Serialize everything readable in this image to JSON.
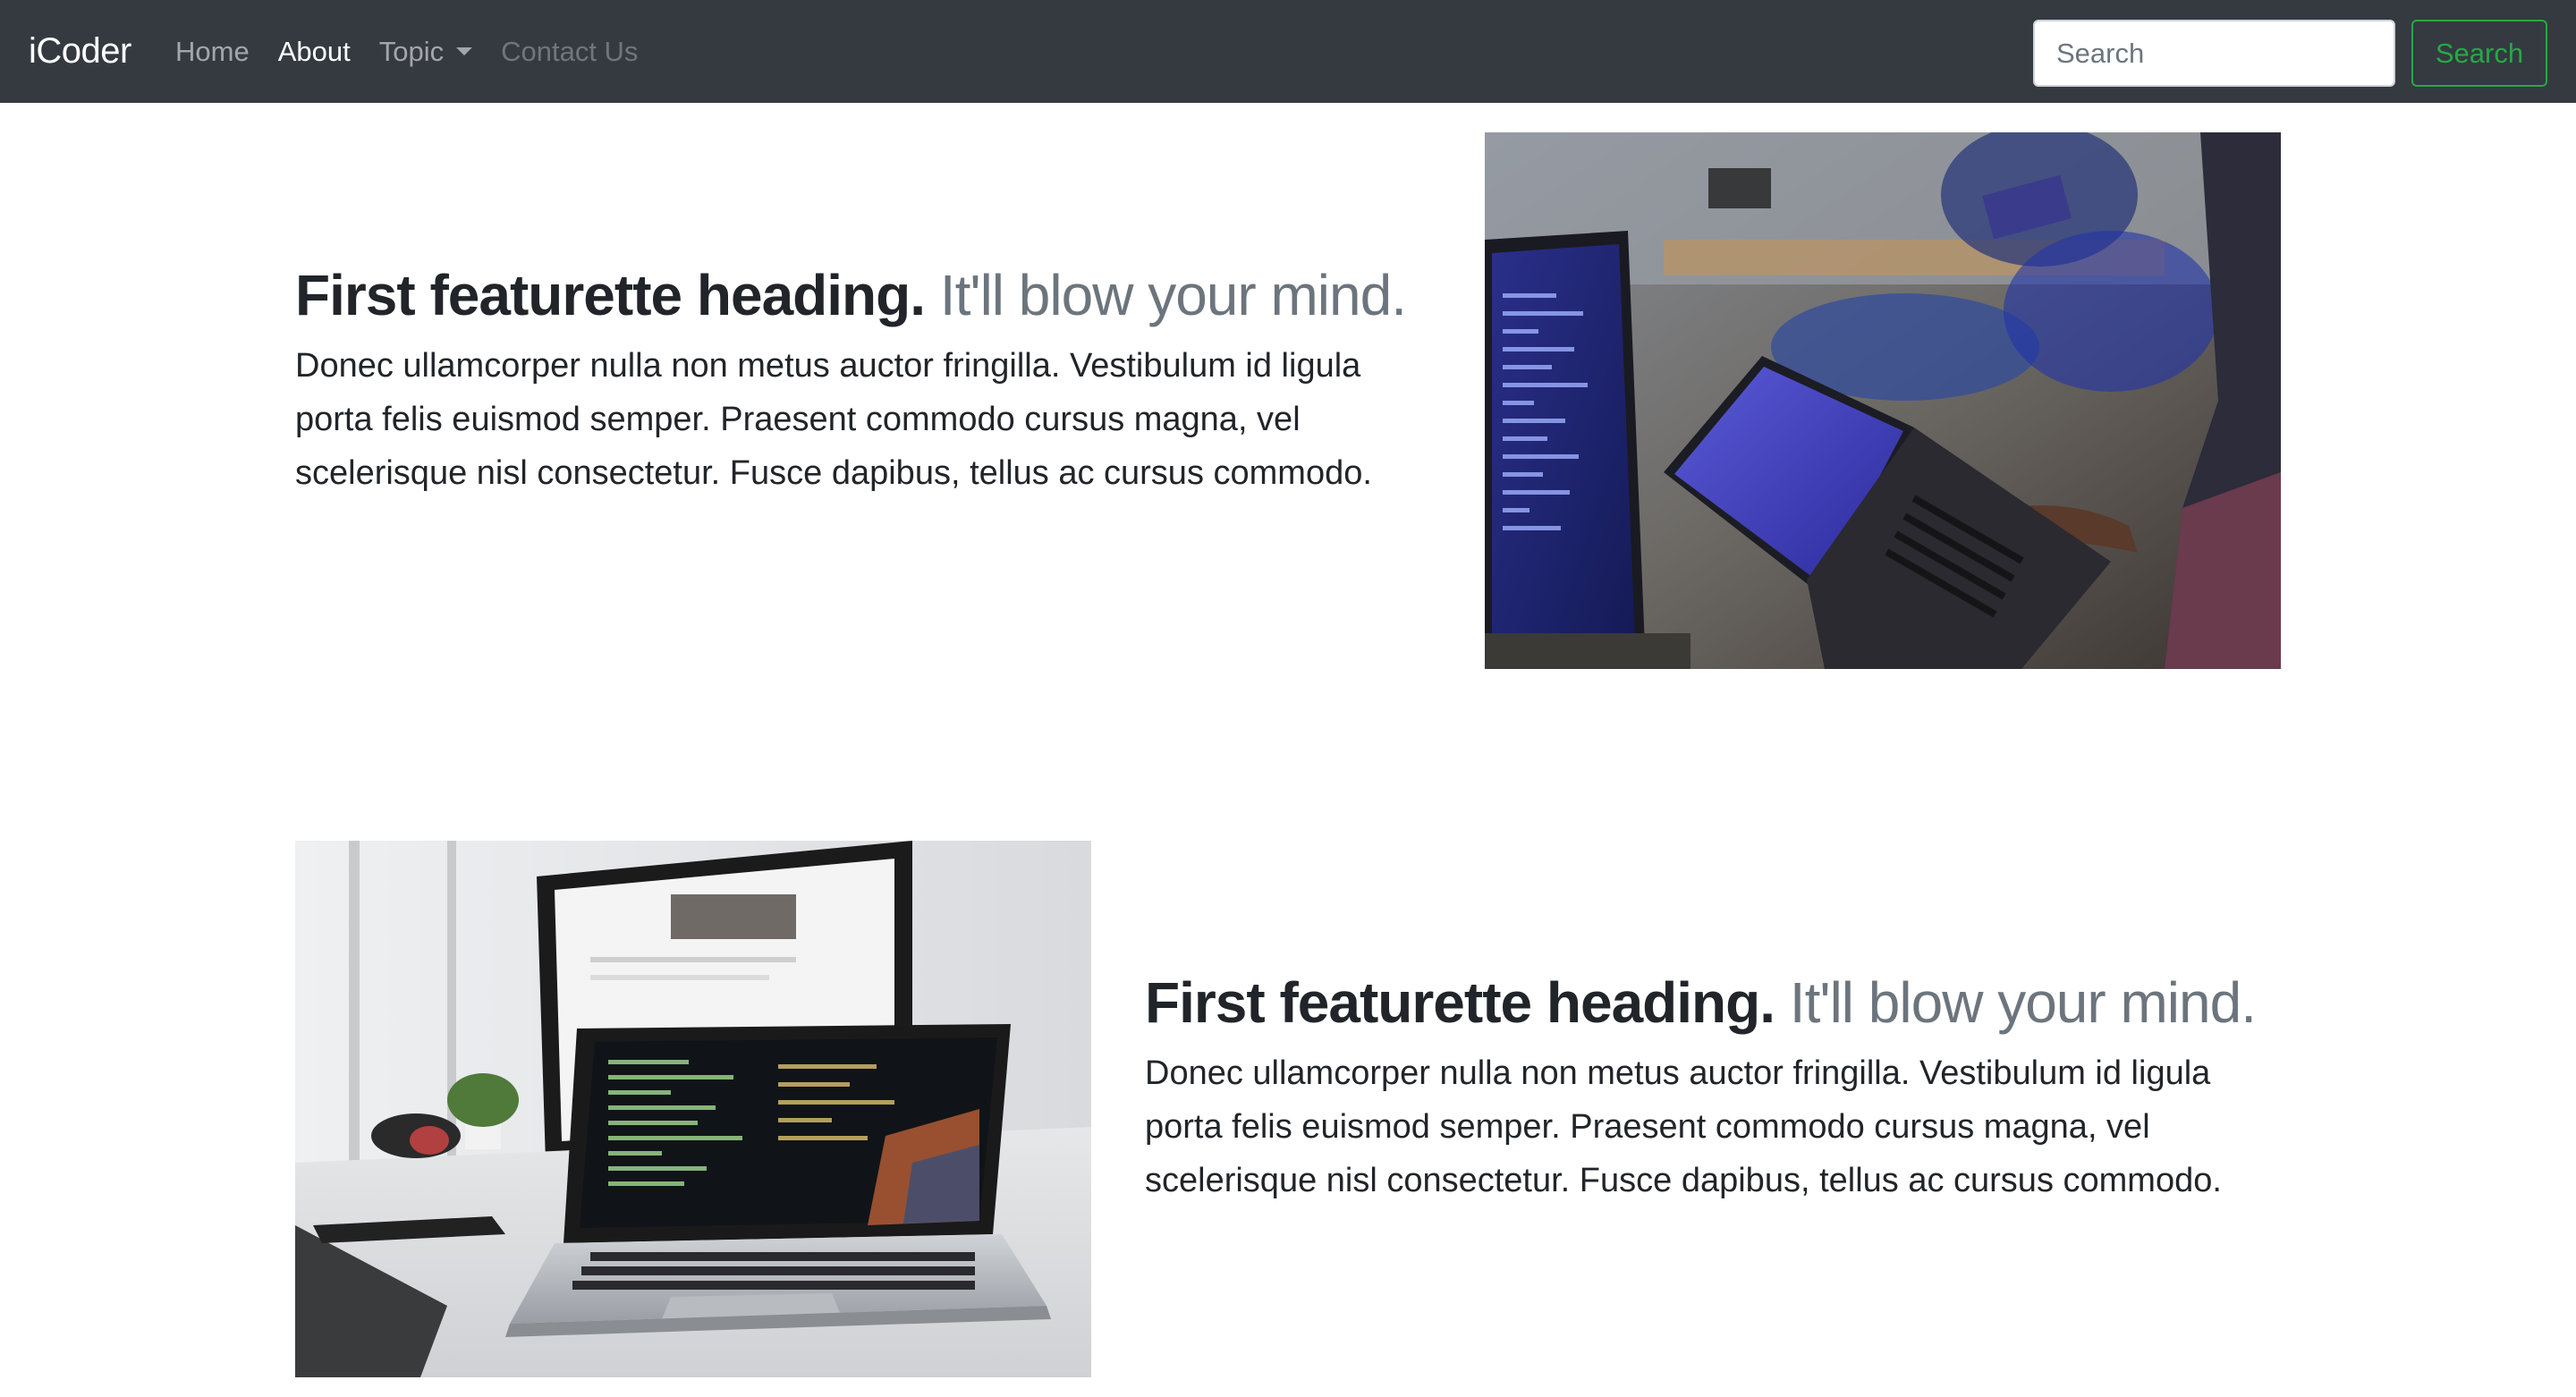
{
  "navbar": {
    "brand": "iCoder",
    "links": [
      {
        "label": "Home",
        "state": "default"
      },
      {
        "label": "About",
        "state": "active"
      },
      {
        "label": "Topic",
        "state": "dropdown"
      },
      {
        "label": "Contact Us",
        "state": "disabled"
      }
    ],
    "search": {
      "placeholder": "Search",
      "value": "",
      "button_label": "Search"
    },
    "colors": {
      "background": "#343a40",
      "button_accent": "#28a745"
    }
  },
  "featurettes": [
    {
      "heading": "First featurette heading.",
      "heading_muted": "It'll blow your mind.",
      "lead": "Donec ullamcorper nulla non metus auctor fringilla. Vestibulum id ligula porta felis euismod semper. Praesent commodo cursus magna, vel scelerisque nisl consectetur. Fusce dapibus, tellus ac cursus commodo.",
      "image": "office-laptops-photo",
      "image_side": "right"
    },
    {
      "heading": "First featurette heading.",
      "heading_muted": "It'll blow your mind.",
      "lead": "Donec ullamcorper nulla non metus auctor fringilla. Vestibulum id ligula porta felis euismod semper. Praesent commodo cursus magna, vel scelerisque nisl consectetur. Fusce dapibus, tellus ac cursus commodo.",
      "image": "macbook-desk-photo",
      "image_side": "left"
    }
  ]
}
